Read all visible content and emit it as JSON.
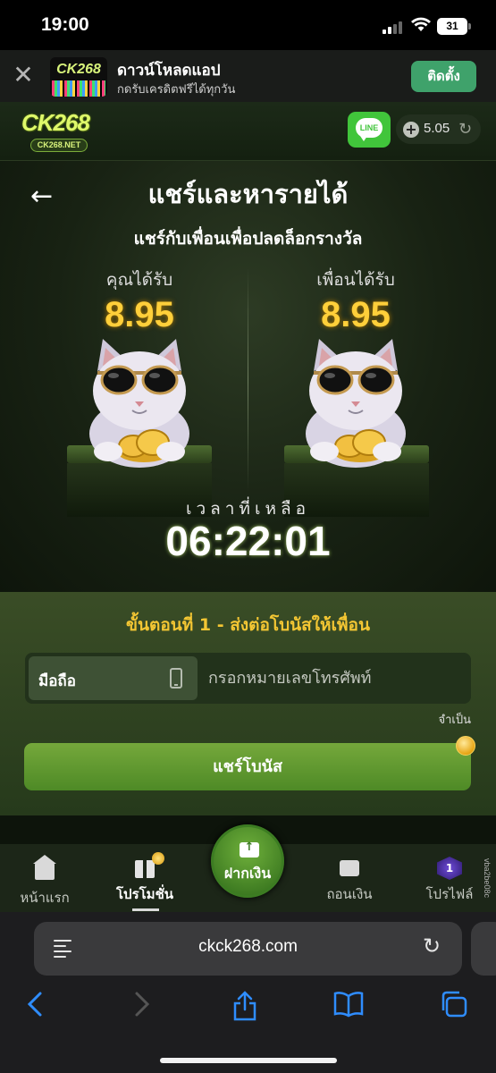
{
  "status_bar": {
    "time": "19:00",
    "battery": "31"
  },
  "app_banner": {
    "close_glyph": "✕",
    "logo_text": "CK268",
    "title": "ดาวน์โหลดแอป",
    "subtitle": "กดรับเครดิตฟรีได้ทุกวัน",
    "install_label": "ติดตั้ง"
  },
  "site_header": {
    "brand": "CK268",
    "brand_sub": "CK268.NET",
    "line_label": "LINE",
    "balance": "5.05"
  },
  "reward": {
    "title": "แชร์และหารายได้",
    "subtitle": "แชร์กับเพื่อนเพื่อปลดล็อกรางวัล",
    "you_label": "คุณได้รับ",
    "you_value": "8.95",
    "friend_label": "เพื่อนได้รับ",
    "friend_value": "8.95",
    "time_left_label": "เวลาที่เหลือ",
    "countdown": "06:22:01"
  },
  "step": {
    "heading": "ขั้นตอนที่ 1 - ส่งต่อโบนัสให้เพื่อน",
    "field_tag": "มือถือ",
    "phone_placeholder": "กรอกหมายเลขโทรศัพท์",
    "required": "จำเป็น",
    "share_button": "แชร์โบนัส"
  },
  "bottom_nav": {
    "home": "หน้าแรก",
    "promotions": "โปรโมชั่น",
    "deposit": "ฝากเงิน",
    "withdraw": "ถอนเงิน",
    "profile": "โปรไฟล์",
    "rank_badge": "1",
    "side_code": "vba2be08c"
  },
  "safari": {
    "url": "ckck268.com"
  },
  "colors": {
    "accent_green": "#4e8a26",
    "gold": "#ffcf3a",
    "step_heading": "#f3c633",
    "safari_blue": "#2f8dff"
  }
}
